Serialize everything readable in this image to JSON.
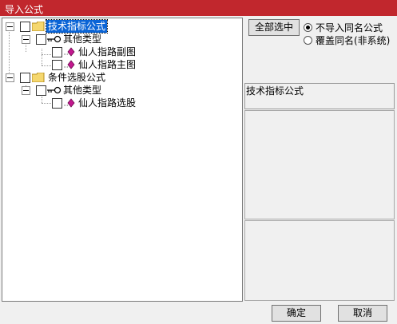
{
  "window": {
    "title": "导入公式"
  },
  "tree": {
    "items": [
      {
        "label": "技术指标公式",
        "level": 0,
        "icon": "folder-icon",
        "selected": true
      },
      {
        "label": "其他类型",
        "level": 1,
        "icon": "key-icon"
      },
      {
        "label": "仙人指路副图",
        "level": 2,
        "icon": "gem-icon"
      },
      {
        "label": "仙人指路主图",
        "level": 2,
        "icon": "gem-icon"
      },
      {
        "label": "条件选股公式",
        "level": 0,
        "icon": "folder-icon"
      },
      {
        "label": "其他类型",
        "level": 1,
        "icon": "key-icon"
      },
      {
        "label": "仙人指路选股",
        "level": 2,
        "icon": "gem-icon"
      }
    ]
  },
  "options": {
    "select_all_label": "全部选中",
    "radio_skip_label": "不导入同名公式",
    "radio_overwrite_label": "覆盖同名(非系统)",
    "selected_radio": "skip"
  },
  "info": {
    "formula_type": "技术指标公式"
  },
  "footer": {
    "ok_label": "确定",
    "cancel_label": "取消"
  },
  "colors": {
    "titlebar": "#c1272d",
    "selection": "#0a64d6"
  }
}
